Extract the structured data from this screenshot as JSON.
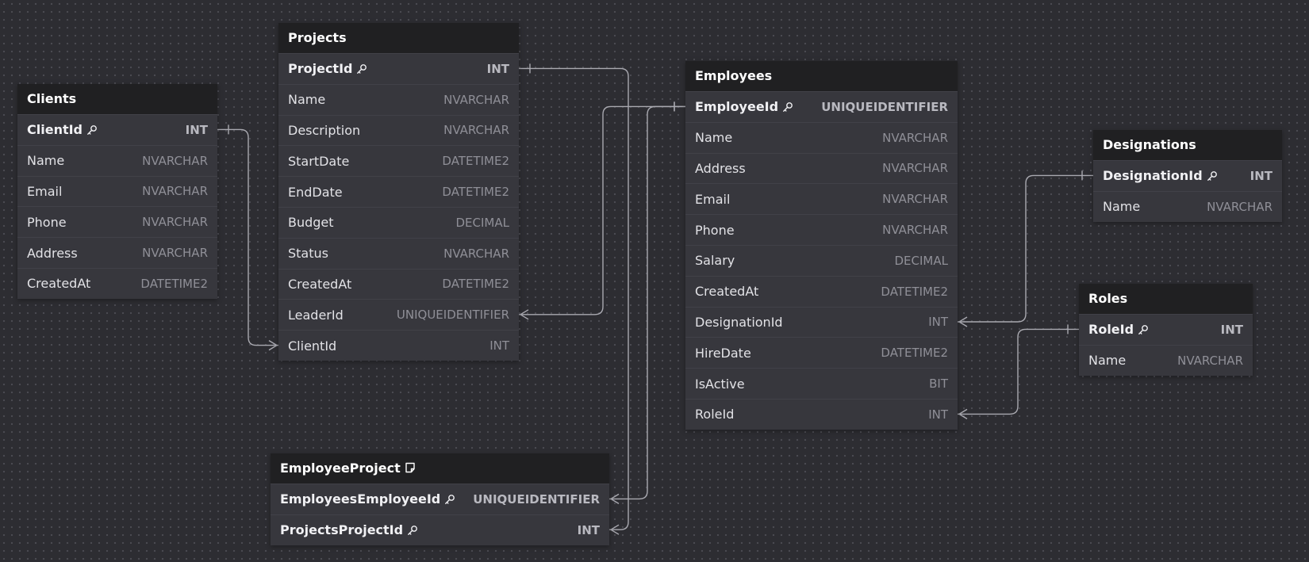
{
  "tables": [
    {
      "id": "clients",
      "title": "Clients",
      "note": false,
      "columns": [
        {
          "name": "ClientId",
          "type": "INT",
          "pk": true
        },
        {
          "name": "Name",
          "type": "NVARCHAR"
        },
        {
          "name": "Email",
          "type": "NVARCHAR"
        },
        {
          "name": "Phone",
          "type": "NVARCHAR"
        },
        {
          "name": "Address",
          "type": "NVARCHAR"
        },
        {
          "name": "CreatedAt",
          "type": "DATETIME2"
        }
      ]
    },
    {
      "id": "projects",
      "title": "Projects",
      "note": false,
      "columns": [
        {
          "name": "ProjectId",
          "type": "INT",
          "pk": true
        },
        {
          "name": "Name",
          "type": "NVARCHAR"
        },
        {
          "name": "Description",
          "type": "NVARCHAR"
        },
        {
          "name": "StartDate",
          "type": "DATETIME2"
        },
        {
          "name": "EndDate",
          "type": "DATETIME2"
        },
        {
          "name": "Budget",
          "type": "DECIMAL"
        },
        {
          "name": "Status",
          "type": "NVARCHAR"
        },
        {
          "name": "CreatedAt",
          "type": "DATETIME2"
        },
        {
          "name": "LeaderId",
          "type": "UNIQUEIDENTIFIER"
        },
        {
          "name": "ClientId",
          "type": "INT"
        }
      ]
    },
    {
      "id": "employees",
      "title": "Employees",
      "note": false,
      "columns": [
        {
          "name": "EmployeeId",
          "type": "UNIQUEIDENTIFIER",
          "pk": true
        },
        {
          "name": "Name",
          "type": "NVARCHAR"
        },
        {
          "name": "Address",
          "type": "NVARCHAR"
        },
        {
          "name": "Email",
          "type": "NVARCHAR"
        },
        {
          "name": "Phone",
          "type": "NVARCHAR"
        },
        {
          "name": "Salary",
          "type": "DECIMAL"
        },
        {
          "name": "CreatedAt",
          "type": "DATETIME2"
        },
        {
          "name": "DesignationId",
          "type": "INT"
        },
        {
          "name": "HireDate",
          "type": "DATETIME2"
        },
        {
          "name": "IsActive",
          "type": "BIT"
        },
        {
          "name": "RoleId",
          "type": "INT"
        }
      ]
    },
    {
      "id": "designations",
      "title": "Designations",
      "note": false,
      "columns": [
        {
          "name": "DesignationId",
          "type": "INT",
          "pk": true
        },
        {
          "name": "Name",
          "type": "NVARCHAR"
        }
      ]
    },
    {
      "id": "roles",
      "title": "Roles",
      "note": false,
      "columns": [
        {
          "name": "RoleId",
          "type": "INT",
          "pk": true
        },
        {
          "name": "Name",
          "type": "NVARCHAR"
        }
      ]
    },
    {
      "id": "employeeproject",
      "title": "EmployeeProject",
      "note": true,
      "columns": [
        {
          "name": "EmployeesEmployeeId",
          "type": "UNIQUEIDENTIFIER",
          "pk": true
        },
        {
          "name": "ProjectsProjectId",
          "type": "INT",
          "pk": true
        }
      ]
    }
  ],
  "relationships": [
    {
      "from": "projects.ClientId",
      "to": "clients.ClientId"
    },
    {
      "from": "projects.LeaderId",
      "to": "employees.EmployeeId"
    },
    {
      "from": "employees.DesignationId",
      "to": "designations.DesignationId"
    },
    {
      "from": "employees.RoleId",
      "to": "roles.RoleId"
    },
    {
      "from": "employeeproject.EmployeesEmployeeId",
      "to": "employees.EmployeeId"
    },
    {
      "from": "employeeproject.ProjectsProjectId",
      "to": "projects.ProjectId"
    }
  ],
  "colors": {
    "canvas": "#2d2d32",
    "table_body": "#37373d",
    "table_header": "#202022",
    "line": "#a9a9b0"
  }
}
